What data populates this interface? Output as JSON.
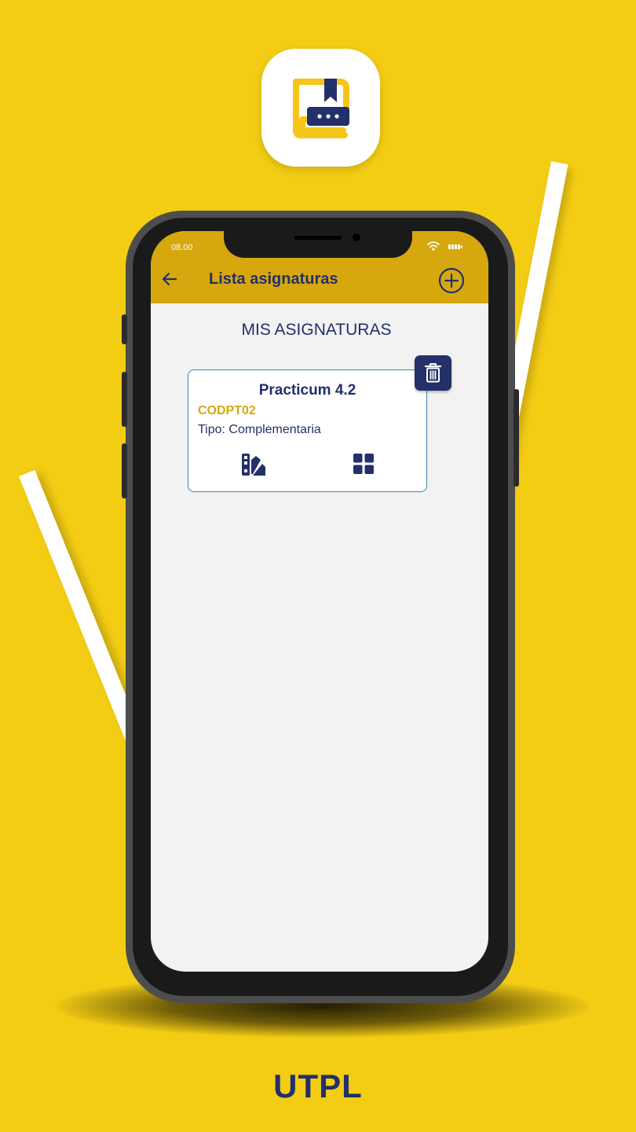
{
  "status_bar": {
    "time": "08.00"
  },
  "app_bar": {
    "title": "Lista asignaturas"
  },
  "section": {
    "title": "MIS ASIGNATURAS"
  },
  "subjects": [
    {
      "name": "Practicum 4.2",
      "code": "CODPT02",
      "type": "Tipo: Complementaria"
    }
  ],
  "brand": "UTPL",
  "colors": {
    "background": "#F3CC14",
    "accent": "#D6A80E",
    "navy": "#23306A",
    "card_border": "#3C83B0"
  },
  "icons": [
    "app-logo-icon",
    "back-arrow-icon",
    "add-circle-icon",
    "trash-icon",
    "palette-swatch-icon",
    "grid-icon",
    "wifi-icon",
    "battery-icon"
  ]
}
